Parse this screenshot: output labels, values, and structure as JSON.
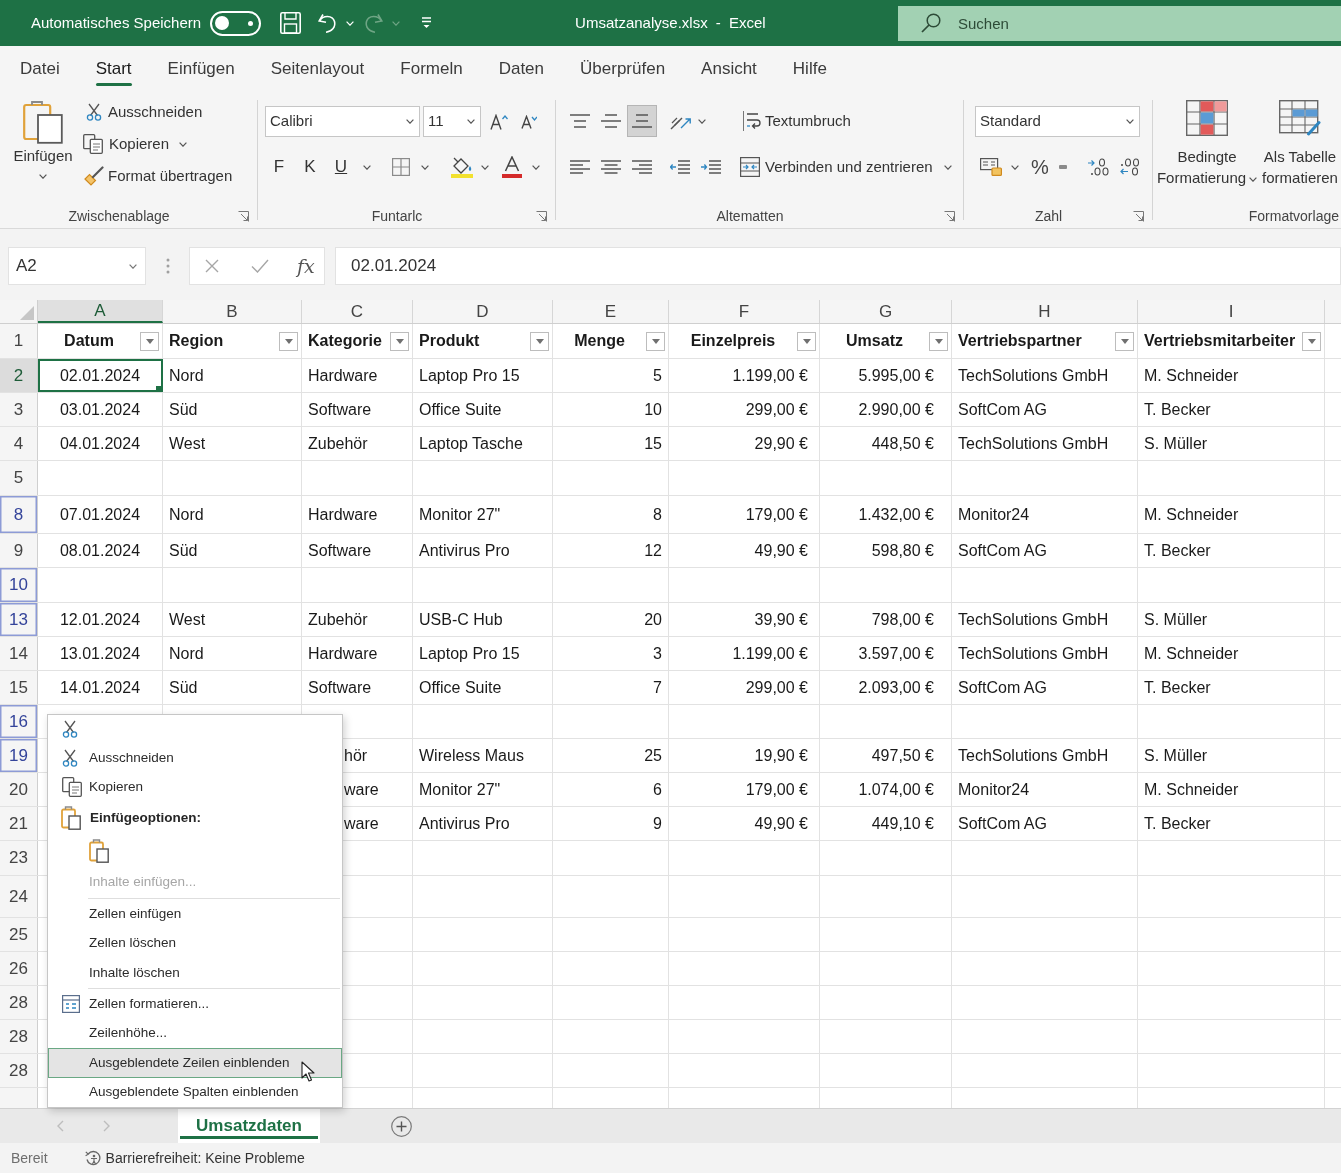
{
  "title_bar": {
    "autosave_label": "Automatisches Speichern",
    "autosave_on": false,
    "document_title": "Umsatzanalyse.xlsx - Excel",
    "search": {
      "placeholder": "Suchen"
    }
  },
  "ribbon_tabs": [
    {
      "label": "Datei",
      "selected": false
    },
    {
      "label": "Start",
      "selected": true
    },
    {
      "label": "Einfügen",
      "selected": false
    },
    {
      "label": "Seitenlayout",
      "selected": false
    },
    {
      "label": "Formeln",
      "selected": false
    },
    {
      "label": "Daten",
      "selected": false
    },
    {
      "label": "Überprüfen",
      "selected": false
    },
    {
      "label": "Ansicht",
      "selected": false
    },
    {
      "label": "Hilfe",
      "selected": false
    }
  ],
  "ribbon": {
    "clipboard": {
      "label": "Zwischenablage",
      "paste": "Einfügen",
      "cut": "Ausschneiden",
      "copy": "Kopieren",
      "format_painter": "Format übertragen"
    },
    "font": {
      "label": "Funtarlc",
      "font_name": "Calibri",
      "font_size": "11",
      "bold": "F",
      "italic": "K",
      "underline": "U"
    },
    "alignment": {
      "label": "Altematten",
      "vertical": [
        {
          "selected": false
        },
        {
          "selected": false
        },
        {
          "selected": true
        }
      ],
      "wrap_text": "Textumbruch",
      "merge": "Verbinden und zentrieren"
    },
    "number": {
      "label": "Zahl",
      "format": "Standard",
      "percent": "%"
    },
    "styles": {
      "label": "Formatvorlage",
      "conditional_formatting": "Bedingte Formatierung",
      "format_as_table": "Als Tabelle formatieren"
    }
  },
  "formula_bar": {
    "name_box": "A2",
    "function_button": "fx",
    "formula": "02.01.2024"
  },
  "columns": [
    {
      "letter": "A",
      "selected": true
    },
    {
      "letter": "B",
      "selected": false
    },
    {
      "letter": "C",
      "selected": false
    },
    {
      "letter": "D",
      "selected": false
    },
    {
      "letter": "E",
      "selected": false
    },
    {
      "letter": "F",
      "selected": false
    },
    {
      "letter": "G",
      "selected": false
    },
    {
      "letter": "H",
      "selected": false
    },
    {
      "letter": "I",
      "selected": false
    }
  ],
  "rows": [
    {
      "number": "1",
      "kind": "header",
      "selected": false,
      "marked": false,
      "cells": [
        "Datum",
        "Region",
        "Kategorie",
        "Produkt",
        "Menge",
        "Einzelpreis",
        "Umsatz",
        "Vertriebspartner",
        "Vertriebsmitarbeiter"
      ]
    },
    {
      "number": "2",
      "kind": "data",
      "selected": true,
      "marked": false,
      "cells": [
        "02.01.2024",
        "Nord",
        "Hardware",
        "Laptop Pro 15",
        "5",
        "1.199,00 €",
        "5.995,00 €",
        "TechSolutions GmbH",
        "M. Schneider"
      ]
    },
    {
      "number": "3",
      "kind": "data",
      "selected": false,
      "marked": false,
      "cells": [
        "03.01.2024",
        "Süd",
        "Software",
        "Office Suite",
        "10",
        "299,00 €",
        "2.990,00 €",
        "SoftCom AG",
        "T. Becker"
      ]
    },
    {
      "number": "4",
      "kind": "data",
      "selected": false,
      "marked": false,
      "cells": [
        "04.01.2024",
        "West",
        "Zubehör",
        "Laptop Tasche",
        "15",
        "29,90 €",
        "448,50 €",
        "TechSolutions GmbH",
        "S. Müller"
      ]
    },
    {
      "number": "5",
      "kind": "data",
      "selected": false,
      "marked": false
    },
    {
      "number": "8",
      "kind": "data",
      "selected": false,
      "marked": true,
      "cells": [
        "07.01.2024",
        "Nord",
        "Hardware",
        "Monitor 27\"",
        "8",
        "179,00 €",
        "1.432,00 €",
        "Monitor24",
        "M. Schneider"
      ]
    },
    {
      "number": "9",
      "kind": "data",
      "selected": false,
      "marked": false,
      "cells": [
        "08.01.2024",
        "Süd",
        "Software",
        "Antivirus Pro",
        "12",
        "49,90 €",
        "598,80 €",
        "SoftCom AG",
        "T. Becker"
      ]
    },
    {
      "number": "10",
      "kind": "data",
      "selected": false,
      "marked": true
    },
    {
      "number": "13",
      "kind": "data",
      "selected": false,
      "marked": true,
      "cells": [
        "12.01.2024",
        "West",
        "Zubehör",
        "USB-C Hub",
        "20",
        "39,90 €",
        "798,00 €",
        "TechSolutions GmbH",
        "S. Müller"
      ]
    },
    {
      "number": "14",
      "kind": "data",
      "selected": false,
      "marked": false,
      "cells": [
        "13.01.2024",
        "Nord",
        "Hardware",
        "Laptop Pro 15",
        "3",
        "1.199,00 €",
        "3.597,00 €",
        "TechSolutions GmbH",
        "M. Schneider"
      ]
    },
    {
      "number": "15",
      "kind": "data",
      "selected": false,
      "marked": false,
      "cells": [
        "14.01.2024",
        "Süd",
        "Software",
        "Office Suite",
        "7",
        "299,00 €",
        "2.093,00 €",
        "SoftCom AG",
        "T. Becker"
      ]
    },
    {
      "number": "16",
      "kind": "data",
      "selected": false,
      "marked": true
    },
    {
      "number": "19",
      "kind": "data",
      "selected": false,
      "marked": true,
      "cells": [
        null,
        null,
        "hör",
        "Wireless Maus",
        "25",
        "19,90 €",
        "497,50 €",
        "TechSolutions GmbH",
        "S. Müller"
      ]
    },
    {
      "number": "20",
      "kind": "data",
      "selected": false,
      "marked": false,
      "cells": [
        null,
        null,
        "ware",
        "Monitor 27\"",
        "6",
        "179,00 €",
        "1.074,00 €",
        "Monitor24",
        "M. Schneider"
      ]
    },
    {
      "number": "21",
      "kind": "data",
      "selected": false,
      "marked": false,
      "cells": [
        null,
        null,
        "ware",
        "Antivirus Pro",
        "9",
        "49,90 €",
        "449,10 €",
        "SoftCom AG",
        "T. Becker"
      ]
    },
    {
      "number": "23",
      "kind": "data",
      "selected": false,
      "marked": false
    },
    {
      "number": "24",
      "kind": "data",
      "selected": false,
      "marked": false
    },
    {
      "number": "25",
      "kind": "data",
      "selected": false,
      "marked": false
    },
    {
      "number": "26",
      "kind": "data",
      "selected": false,
      "marked": false
    },
    {
      "number": "28",
      "kind": "data",
      "selected": false,
      "marked": false
    },
    {
      "number": "28",
      "kind": "data",
      "selected": false,
      "marked": false
    },
    {
      "number": "28",
      "kind": "data",
      "selected": false,
      "marked": false
    }
  ],
  "context_menu": {
    "items": [
      {
        "kind": "ghost"
      },
      {
        "kind": "cut",
        "label": "Ausschneiden",
        "disabled": false,
        "hovered": false
      },
      {
        "kind": "copy",
        "label": "Kopieren",
        "disabled": false,
        "hovered": false
      },
      {
        "kind": "heading",
        "label": "Einfügeoptionen:"
      },
      {
        "kind": "paste"
      },
      {
        "kind": "plain",
        "label": "Inhalte einfügen...",
        "disabled": true,
        "hovered": false
      },
      {
        "kind": "separator"
      },
      {
        "kind": "plain",
        "label": "Zellen einfügen",
        "disabled": false,
        "hovered": false
      },
      {
        "kind": "plain",
        "label": "Zellen löschen",
        "disabled": false,
        "hovered": false
      },
      {
        "kind": "plain",
        "label": "Inhalte löschen",
        "disabled": false,
        "hovered": false
      },
      {
        "kind": "separator"
      },
      {
        "kind": "format",
        "label": "Zellen formatieren...",
        "disabled": false,
        "hovered": false
      },
      {
        "kind": "plain",
        "label": "Zeilenhöhe...",
        "disabled": false,
        "hovered": false
      },
      {
        "kind": "plain",
        "label": "Ausgeblendete Zeilen einblenden",
        "disabled": false,
        "hovered": true
      },
      {
        "kind": "plain",
        "label": "Ausgeblendete Spalten einblenden",
        "disabled": false,
        "hovered": false
      }
    ]
  },
  "sheet_tabs": [
    {
      "label": "Umsatzdaten",
      "selected": true
    }
  ],
  "status_bar": {
    "mode": "Bereit",
    "accessibility": "Barrierefreiheit: Keine Probleme"
  }
}
